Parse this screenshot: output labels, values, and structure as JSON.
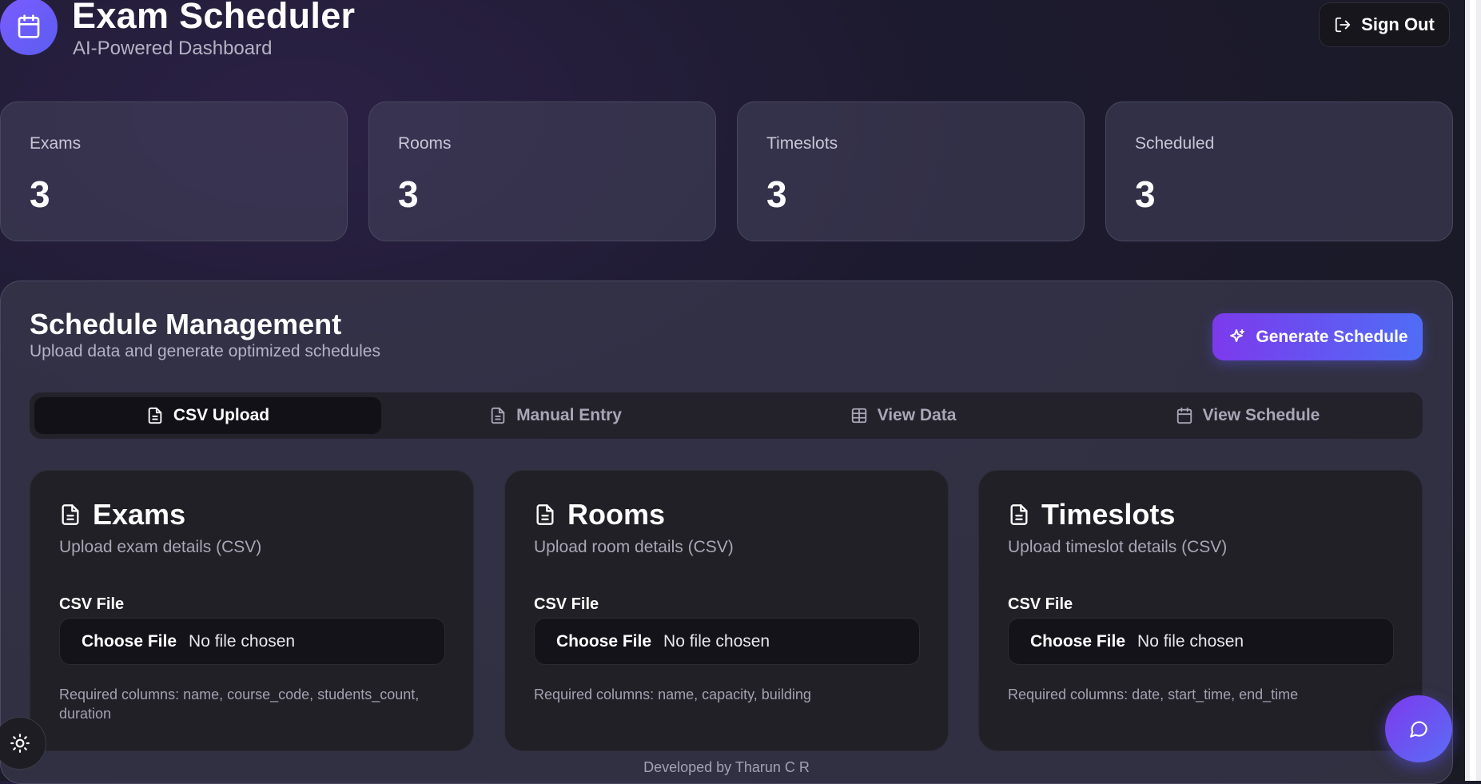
{
  "header": {
    "title": "Exam Scheduler",
    "subtitle": "AI-Powered Dashboard",
    "sign_out_label": "Sign Out"
  },
  "stats": [
    {
      "label": "Exams",
      "value": "3"
    },
    {
      "label": "Rooms",
      "value": "3"
    },
    {
      "label": "Timeslots",
      "value": "3"
    },
    {
      "label": "Scheduled",
      "value": "3"
    }
  ],
  "panel": {
    "title": "Schedule Management",
    "subtitle": "Upload data and generate optimized schedules",
    "generate_label": "Generate Schedule",
    "tabs": [
      {
        "label": "CSV Upload",
        "icon": "file-text-icon",
        "active": true
      },
      {
        "label": "Manual Entry",
        "icon": "file-text-icon",
        "active": false
      },
      {
        "label": "View Data",
        "icon": "table-icon",
        "active": false
      },
      {
        "label": "View Schedule",
        "icon": "calendar-icon",
        "active": false
      }
    ],
    "cards": [
      {
        "title": "Exams",
        "subtitle": "Upload exam details (CSV)",
        "field_label": "CSV File",
        "choose_label": "Choose File",
        "file_status": "No file chosen",
        "required": "Required columns: name, course_code, students_count, duration"
      },
      {
        "title": "Rooms",
        "subtitle": "Upload room details (CSV)",
        "field_label": "CSV File",
        "choose_label": "Choose File",
        "file_status": "No file chosen",
        "required": "Required columns: name, capacity, building"
      },
      {
        "title": "Timeslots",
        "subtitle": "Upload timeslot details (CSV)",
        "field_label": "CSV File",
        "choose_label": "Choose File",
        "file_status": "No file chosen",
        "required": "Required columns: date, start_time, end_time"
      }
    ]
  },
  "footer": {
    "text": "Developed by Tharun C R"
  },
  "colors": {
    "accent_start": "#7c3aed",
    "accent_end": "#4f6df5",
    "background": "#1c1a2e"
  }
}
